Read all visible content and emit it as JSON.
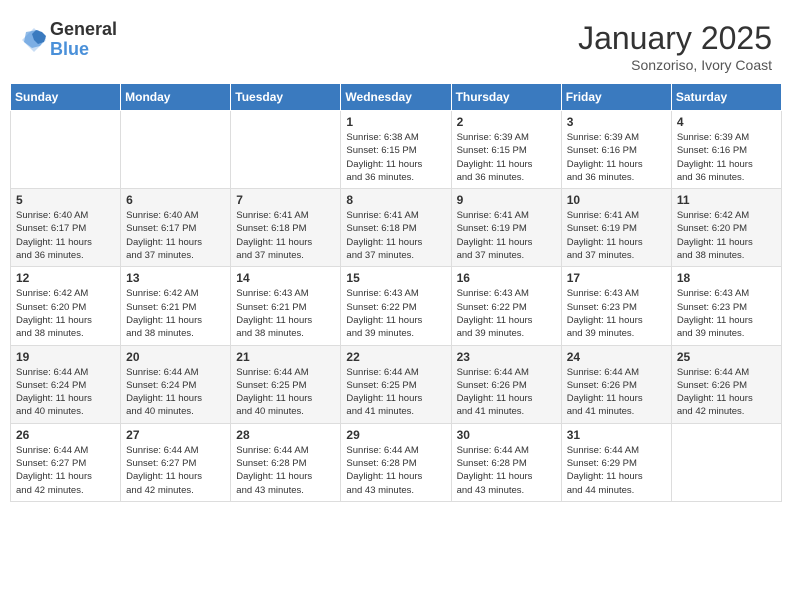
{
  "header": {
    "logo_general": "General",
    "logo_blue": "Blue",
    "month_title": "January 2025",
    "location": "Sonzoriso, Ivory Coast"
  },
  "days_of_week": [
    "Sunday",
    "Monday",
    "Tuesday",
    "Wednesday",
    "Thursday",
    "Friday",
    "Saturday"
  ],
  "weeks": [
    [
      {
        "day": "",
        "info": ""
      },
      {
        "day": "",
        "info": ""
      },
      {
        "day": "",
        "info": ""
      },
      {
        "day": "1",
        "info": "Sunrise: 6:38 AM\nSunset: 6:15 PM\nDaylight: 11 hours\nand 36 minutes."
      },
      {
        "day": "2",
        "info": "Sunrise: 6:39 AM\nSunset: 6:15 PM\nDaylight: 11 hours\nand 36 minutes."
      },
      {
        "day": "3",
        "info": "Sunrise: 6:39 AM\nSunset: 6:16 PM\nDaylight: 11 hours\nand 36 minutes."
      },
      {
        "day": "4",
        "info": "Sunrise: 6:39 AM\nSunset: 6:16 PM\nDaylight: 11 hours\nand 36 minutes."
      }
    ],
    [
      {
        "day": "5",
        "info": "Sunrise: 6:40 AM\nSunset: 6:17 PM\nDaylight: 11 hours\nand 36 minutes."
      },
      {
        "day": "6",
        "info": "Sunrise: 6:40 AM\nSunset: 6:17 PM\nDaylight: 11 hours\nand 37 minutes."
      },
      {
        "day": "7",
        "info": "Sunrise: 6:41 AM\nSunset: 6:18 PM\nDaylight: 11 hours\nand 37 minutes."
      },
      {
        "day": "8",
        "info": "Sunrise: 6:41 AM\nSunset: 6:18 PM\nDaylight: 11 hours\nand 37 minutes."
      },
      {
        "day": "9",
        "info": "Sunrise: 6:41 AM\nSunset: 6:19 PM\nDaylight: 11 hours\nand 37 minutes."
      },
      {
        "day": "10",
        "info": "Sunrise: 6:41 AM\nSunset: 6:19 PM\nDaylight: 11 hours\nand 37 minutes."
      },
      {
        "day": "11",
        "info": "Sunrise: 6:42 AM\nSunset: 6:20 PM\nDaylight: 11 hours\nand 38 minutes."
      }
    ],
    [
      {
        "day": "12",
        "info": "Sunrise: 6:42 AM\nSunset: 6:20 PM\nDaylight: 11 hours\nand 38 minutes."
      },
      {
        "day": "13",
        "info": "Sunrise: 6:42 AM\nSunset: 6:21 PM\nDaylight: 11 hours\nand 38 minutes."
      },
      {
        "day": "14",
        "info": "Sunrise: 6:43 AM\nSunset: 6:21 PM\nDaylight: 11 hours\nand 38 minutes."
      },
      {
        "day": "15",
        "info": "Sunrise: 6:43 AM\nSunset: 6:22 PM\nDaylight: 11 hours\nand 39 minutes."
      },
      {
        "day": "16",
        "info": "Sunrise: 6:43 AM\nSunset: 6:22 PM\nDaylight: 11 hours\nand 39 minutes."
      },
      {
        "day": "17",
        "info": "Sunrise: 6:43 AM\nSunset: 6:23 PM\nDaylight: 11 hours\nand 39 minutes."
      },
      {
        "day": "18",
        "info": "Sunrise: 6:43 AM\nSunset: 6:23 PM\nDaylight: 11 hours\nand 39 minutes."
      }
    ],
    [
      {
        "day": "19",
        "info": "Sunrise: 6:44 AM\nSunset: 6:24 PM\nDaylight: 11 hours\nand 40 minutes."
      },
      {
        "day": "20",
        "info": "Sunrise: 6:44 AM\nSunset: 6:24 PM\nDaylight: 11 hours\nand 40 minutes."
      },
      {
        "day": "21",
        "info": "Sunrise: 6:44 AM\nSunset: 6:25 PM\nDaylight: 11 hours\nand 40 minutes."
      },
      {
        "day": "22",
        "info": "Sunrise: 6:44 AM\nSunset: 6:25 PM\nDaylight: 11 hours\nand 41 minutes."
      },
      {
        "day": "23",
        "info": "Sunrise: 6:44 AM\nSunset: 6:26 PM\nDaylight: 11 hours\nand 41 minutes."
      },
      {
        "day": "24",
        "info": "Sunrise: 6:44 AM\nSunset: 6:26 PM\nDaylight: 11 hours\nand 41 minutes."
      },
      {
        "day": "25",
        "info": "Sunrise: 6:44 AM\nSunset: 6:26 PM\nDaylight: 11 hours\nand 42 minutes."
      }
    ],
    [
      {
        "day": "26",
        "info": "Sunrise: 6:44 AM\nSunset: 6:27 PM\nDaylight: 11 hours\nand 42 minutes."
      },
      {
        "day": "27",
        "info": "Sunrise: 6:44 AM\nSunset: 6:27 PM\nDaylight: 11 hours\nand 42 minutes."
      },
      {
        "day": "28",
        "info": "Sunrise: 6:44 AM\nSunset: 6:28 PM\nDaylight: 11 hours\nand 43 minutes."
      },
      {
        "day": "29",
        "info": "Sunrise: 6:44 AM\nSunset: 6:28 PM\nDaylight: 11 hours\nand 43 minutes."
      },
      {
        "day": "30",
        "info": "Sunrise: 6:44 AM\nSunset: 6:28 PM\nDaylight: 11 hours\nand 43 minutes."
      },
      {
        "day": "31",
        "info": "Sunrise: 6:44 AM\nSunset: 6:29 PM\nDaylight: 11 hours\nand 44 minutes."
      },
      {
        "day": "",
        "info": ""
      }
    ]
  ]
}
